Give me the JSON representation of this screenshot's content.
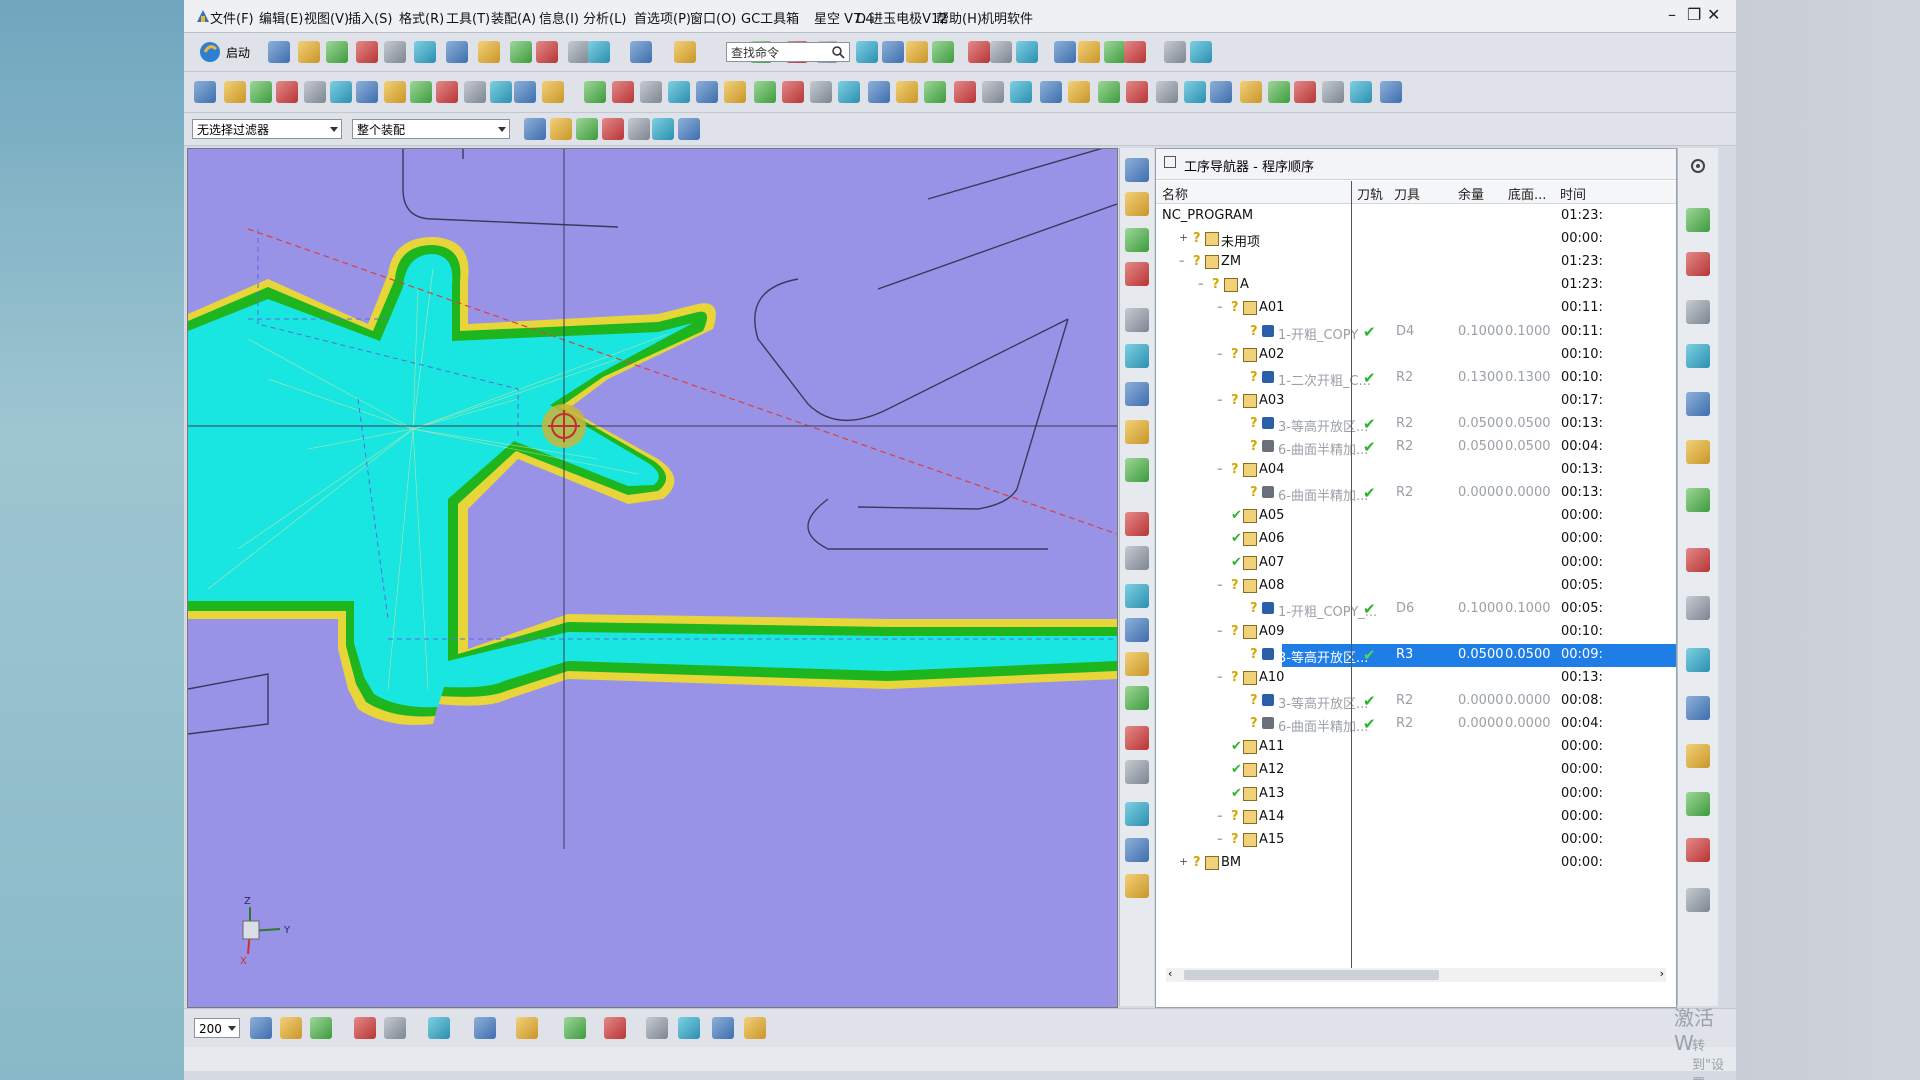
{
  "menu": [
    "文件(F)",
    "编辑(E)",
    "视图(V)",
    "插入(S)",
    "格式(R)",
    "工具(T)",
    "装配(A)",
    "信息(I)",
    "分析(L)",
    "首选项(P)",
    "窗口(O)",
    "GC工具箱",
    "星空 V7.4",
    "D 进玉电极V12",
    "帮助(H)",
    "机明软件"
  ],
  "toolbar": {
    "start_label": "启动",
    "search_placeholder": "查找命令"
  },
  "filters": {
    "selection_filter": "无选择过滤器",
    "assembly_scope": "整个装配"
  },
  "bottom": {
    "zoom_value": "200"
  },
  "navigator": {
    "title": "工序导航器 - 程序顺序",
    "columns": [
      "名称",
      "刀轨",
      "刀具",
      "余量",
      "底面...",
      "时间"
    ],
    "rows": [
      {
        "name": "NC_PROGRAM",
        "time": "01:23:",
        "indent": 0,
        "kind": "root"
      },
      {
        "name": "未用项",
        "time": "00:00:",
        "indent": 1,
        "kind": "folder"
      },
      {
        "name": "ZM",
        "time": "01:23:",
        "indent": 1,
        "kind": "folder"
      },
      {
        "name": "A",
        "time": "01:23:",
        "indent": 2,
        "kind": "folder"
      },
      {
        "name": "A01",
        "time": "00:11:",
        "indent": 3,
        "kind": "folder"
      },
      {
        "name": "1-开粗_COPY",
        "toolpath": "✔",
        "tool": "D4",
        "stock": "0.1000",
        "floor": "0.1000",
        "time": "00:11:",
        "indent": 4,
        "kind": "op"
      },
      {
        "name": "A02",
        "time": "00:10:",
        "indent": 3,
        "kind": "folder"
      },
      {
        "name": "1-二次开粗_C...",
        "toolpath": "✔",
        "tool": "R2",
        "stock": "0.1300",
        "floor": "0.1300",
        "time": "00:10:",
        "indent": 4,
        "kind": "op"
      },
      {
        "name": "A03",
        "time": "00:17:",
        "indent": 3,
        "kind": "folder"
      },
      {
        "name": "3-等高开放区...",
        "toolpath": "✔",
        "tool": "R2",
        "stock": "0.0500",
        "floor": "0.0500",
        "time": "00:13:",
        "indent": 4,
        "kind": "op"
      },
      {
        "name": "6-曲面半精加...",
        "toolpath": "✔",
        "tool": "R2",
        "stock": "0.0500",
        "floor": "0.0500",
        "time": "00:04:",
        "indent": 4,
        "kind": "op2"
      },
      {
        "name": "A04",
        "time": "00:13:",
        "indent": 3,
        "kind": "folder"
      },
      {
        "name": "6-曲面半精加...",
        "toolpath": "✔",
        "tool": "R2",
        "stock": "0.0000",
        "floor": "0.0000",
        "time": "00:13:",
        "indent": 4,
        "kind": "op2"
      },
      {
        "name": "A05",
        "time": "00:00:",
        "indent": 3,
        "kind": "done"
      },
      {
        "name": "A06",
        "time": "00:00:",
        "indent": 3,
        "kind": "done"
      },
      {
        "name": "A07",
        "time": "00:00:",
        "indent": 3,
        "kind": "done"
      },
      {
        "name": "A08",
        "time": "00:05:",
        "indent": 3,
        "kind": "folder"
      },
      {
        "name": "1-开粗_COPY_...",
        "toolpath": "✔",
        "tool": "D6",
        "stock": "0.1000",
        "floor": "0.1000",
        "time": "00:05:",
        "indent": 4,
        "kind": "op"
      },
      {
        "name": "A09",
        "time": "00:10:",
        "indent": 3,
        "kind": "folder"
      },
      {
        "name": "3-等高开放区...",
        "toolpath": "✔",
        "tool": "R3",
        "stock": "0.0500",
        "floor": "0.0500",
        "time": "00:09:",
        "indent": 4,
        "kind": "op",
        "selected": true
      },
      {
        "name": "A10",
        "time": "00:13:",
        "indent": 3,
        "kind": "folder"
      },
      {
        "name": "3-等高开放区...",
        "toolpath": "✔",
        "tool": "R2",
        "stock": "0.0000",
        "floor": "0.0000",
        "time": "00:08:",
        "indent": 4,
        "kind": "op"
      },
      {
        "name": "6-曲面半精加...",
        "toolpath": "✔",
        "tool": "R2",
        "stock": "0.0000",
        "floor": "0.0000",
        "time": "00:04:",
        "indent": 4,
        "kind": "op2"
      },
      {
        "name": "A11",
        "time": "00:00:",
        "indent": 3,
        "kind": "done"
      },
      {
        "name": "A12",
        "time": "00:00:",
        "indent": 3,
        "kind": "done"
      },
      {
        "name": "A13",
        "time": "00:00:",
        "indent": 3,
        "kind": "done"
      },
      {
        "name": "A14",
        "time": "00:00:",
        "indent": 3,
        "kind": "folder"
      },
      {
        "name": "A15",
        "time": "00:00:",
        "indent": 3,
        "kind": "folder"
      },
      {
        "name": "BM",
        "time": "00:00:",
        "indent": 1,
        "kind": "folder"
      }
    ]
  },
  "axes": {
    "z": "Z",
    "y": "Y",
    "x": "X"
  },
  "watermark": {
    "line1": "激活 W",
    "line2": "转到\"设置"
  },
  "colors": {
    "viewport_bg": "#9993e8",
    "toolpath_cyan": "#19e6e0",
    "part_green": "#1fb51f",
    "selection_blue": "#1f7de6"
  }
}
